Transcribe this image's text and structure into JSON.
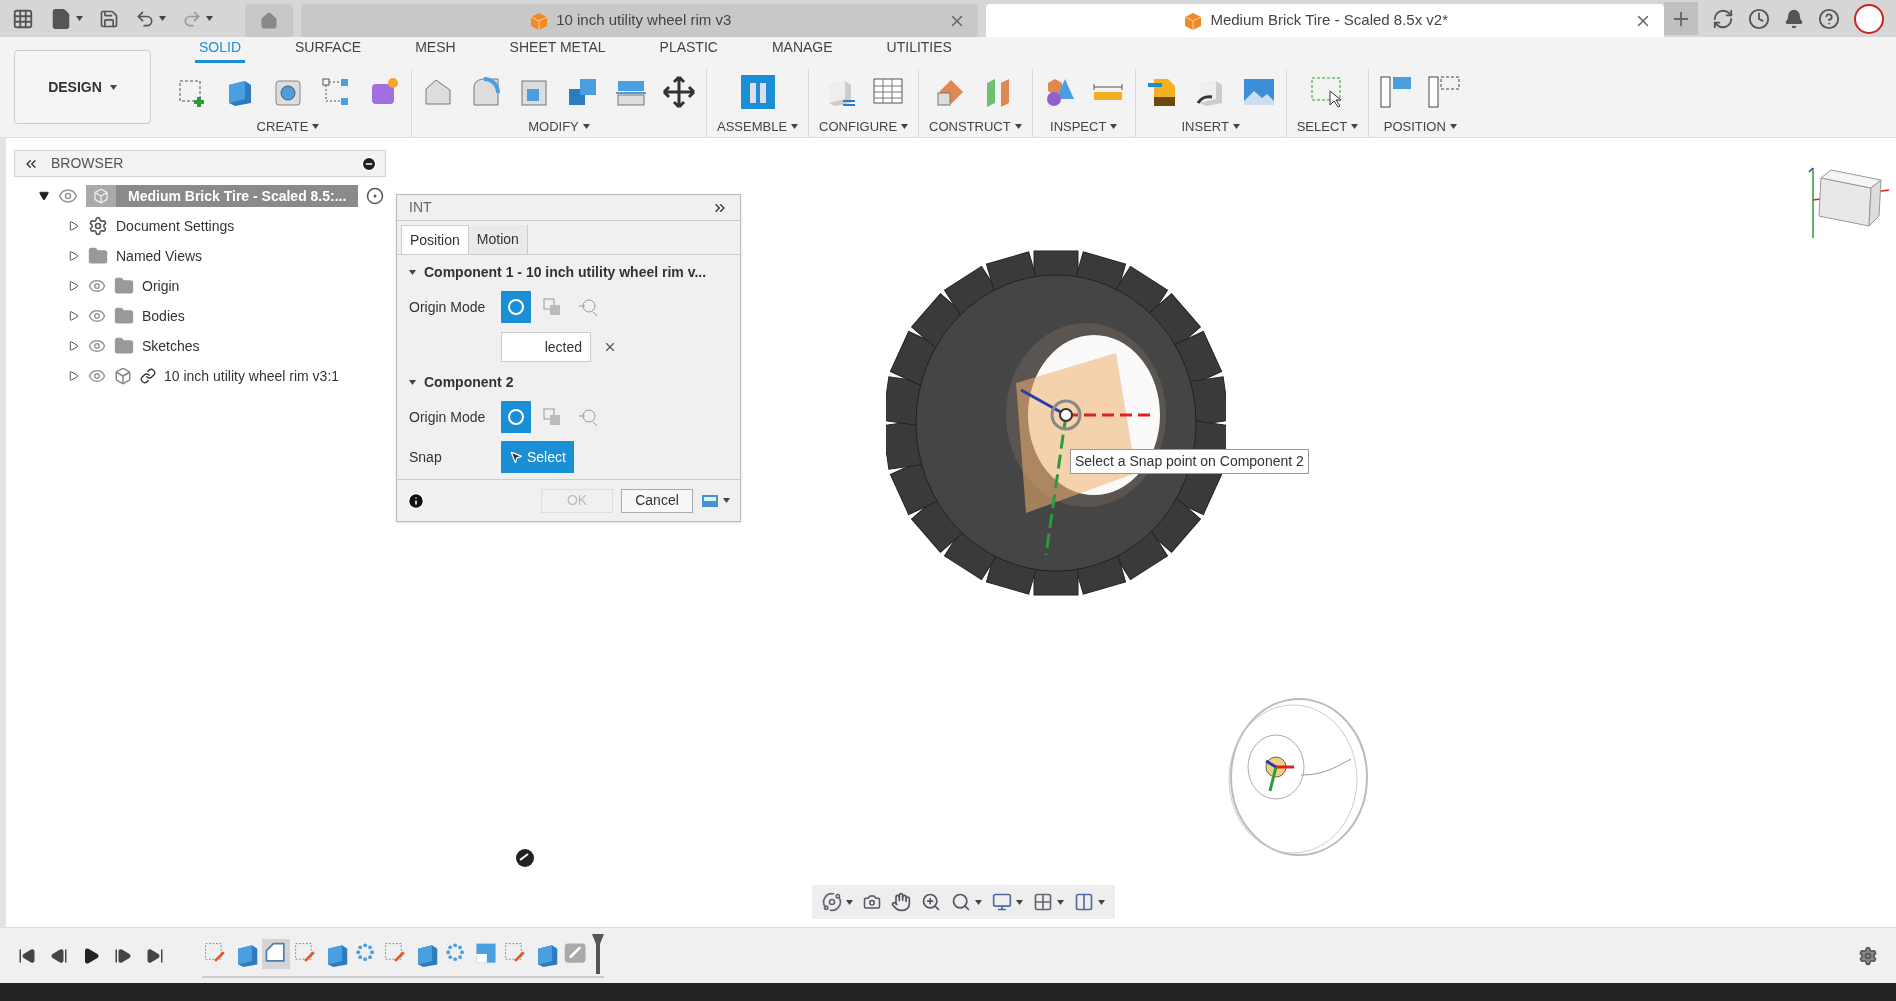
{
  "document_tabs": [
    {
      "title": "10 inch utility wheel rim v3",
      "selected": false
    },
    {
      "title": "Medium Brick Tire - Scaled 8.5x v2*",
      "selected": true
    }
  ],
  "workspace": {
    "label": "DESIGN"
  },
  "ribbon_tabs": [
    {
      "label": "SOLID",
      "selected": true
    },
    {
      "label": "SURFACE",
      "selected": false
    },
    {
      "label": "MESH",
      "selected": false
    },
    {
      "label": "SHEET METAL",
      "selected": false
    },
    {
      "label": "PLASTIC",
      "selected": false
    },
    {
      "label": "MANAGE",
      "selected": false
    },
    {
      "label": "UTILITIES",
      "selected": false
    }
  ],
  "ribbon_groups": [
    {
      "label": "CREATE"
    },
    {
      "label": "MODIFY"
    },
    {
      "label": "ASSEMBLE"
    },
    {
      "label": "CONFIGURE"
    },
    {
      "label": "CONSTRUCT"
    },
    {
      "label": "INSPECT"
    },
    {
      "label": "INSERT"
    },
    {
      "label": "SELECT"
    },
    {
      "label": "POSITION"
    }
  ],
  "browser": {
    "title": "BROWSER",
    "root": {
      "label": "Medium Brick Tire - Scaled 8.5:...",
      "expanded": true,
      "children": [
        {
          "label": "Document Settings",
          "kind": "settings",
          "expanded": false
        },
        {
          "label": "Named Views",
          "kind": "views",
          "expanded": false
        },
        {
          "label": "Origin",
          "kind": "folder",
          "expanded": false
        },
        {
          "label": "Bodies",
          "kind": "folder",
          "expanded": false
        },
        {
          "label": "Sketches",
          "kind": "folder",
          "expanded": false
        },
        {
          "label": "10 inch utility wheel rim v3:1",
          "kind": "component",
          "expanded": false
        }
      ]
    }
  },
  "dialog": {
    "title": "INT",
    "tabs": [
      {
        "label": "Position",
        "selected": true
      },
      {
        "label": "Motion",
        "selected": false
      }
    ],
    "sections": [
      {
        "title": "Component 1 - 10 inch utility wheel rim v...",
        "expanded": true,
        "rows": [
          {
            "kind": "mode",
            "label": "Origin Mode",
            "modes": [
              {
                "selected": true
              },
              {
                "selected": false
              },
              {
                "selected": false
              }
            ]
          },
          {
            "kind": "selection",
            "value": "lected"
          }
        ]
      },
      {
        "title": "Component 2",
        "expanded": true,
        "rows": [
          {
            "kind": "mode",
            "label": "Origin Mode",
            "modes": [
              {
                "selected": true
              },
              {
                "selected": false
              },
              {
                "selected": false
              }
            ]
          },
          {
            "kind": "select",
            "label": "Snap",
            "button": "Select"
          }
        ]
      }
    ],
    "buttons": [
      {
        "label": "OK",
        "disabled": true
      },
      {
        "label": "Cancel",
        "disabled": false
      }
    ]
  },
  "tooltip": "Select a Snap point on Component 2",
  "timeline": [
    {
      "kind": "sketch",
      "selected": false
    },
    {
      "kind": "extrude",
      "selected": false
    },
    {
      "kind": "fillet",
      "selected": true
    },
    {
      "kind": "sketch",
      "selected": false
    },
    {
      "kind": "extrude",
      "selected": false
    },
    {
      "kind": "pattern",
      "selected": false
    },
    {
      "kind": "sketch",
      "selected": false
    },
    {
      "kind": "extrude",
      "selected": false
    },
    {
      "kind": "pattern",
      "selected": false
    },
    {
      "kind": "shell",
      "selected": false
    },
    {
      "kind": "sketch",
      "selected": false
    },
    {
      "kind": "extrude",
      "selected": false
    },
    {
      "kind": "joint",
      "selected": false
    }
  ]
}
